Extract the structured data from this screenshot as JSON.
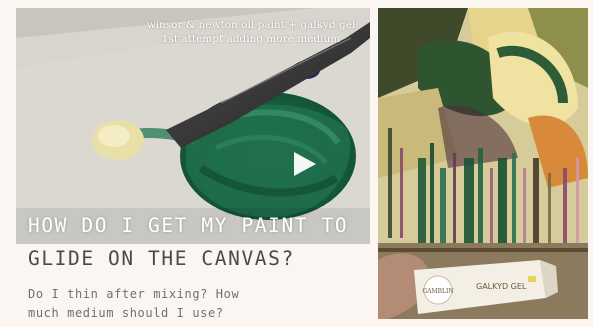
{
  "video": {
    "caption_line1": "winsor & newton oil paint + galkyd gel",
    "caption_line2": "1st attempt adding more medium",
    "play_icon": "play-icon"
  },
  "article": {
    "headline_line1": "HOW DO I GET MY PAINT TO",
    "headline_line2": "GLIDE ON THE CANVAS?",
    "body_line1": "Do I thin after mixing? How",
    "body_line2": "much medium should I use?"
  },
  "photo": {
    "tube_brand": "GAMBLIN",
    "tube_label": "GALKYD GEL"
  },
  "colors": {
    "background": "#fbf6f2",
    "paint_green": "#1d6a4a",
    "paint_cream": "#e9dfa8"
  }
}
